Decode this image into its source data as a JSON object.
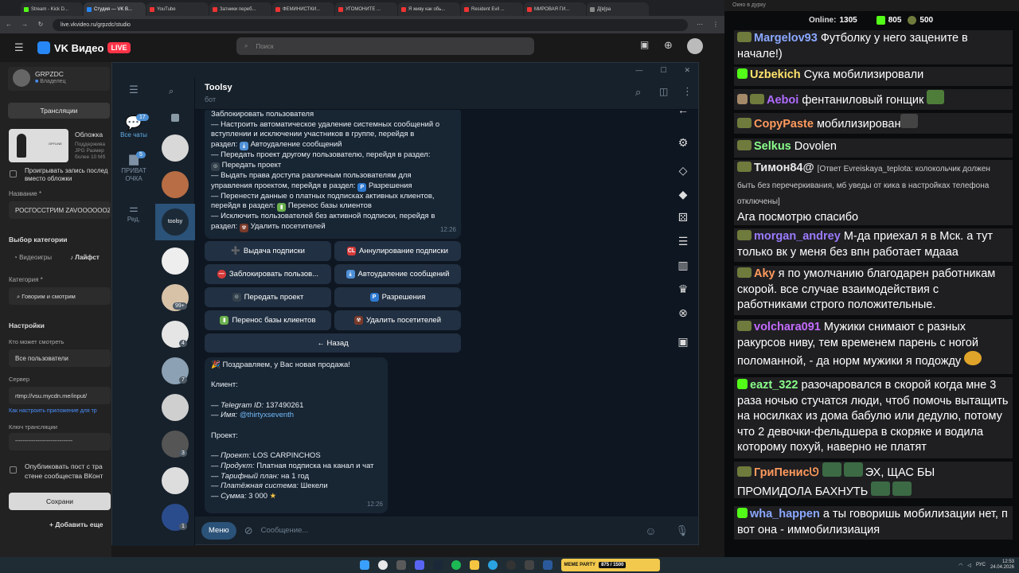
{
  "browser": {
    "tabs": [
      "Stream - Kick D...",
      "Студия — VK В...",
      "YouTube",
      "Затники переб...",
      "ФЕМИНИСТКИ...",
      "УГОМОНИТЕ ...",
      "Я живу как обь...",
      "Resident Evil ...",
      "МИРОВАЯ ГИ...",
      "Д[в]ра"
    ],
    "url": "live.vkvideo.ru/grpzdc/studio"
  },
  "vk": {
    "logo": "VK Видео",
    "live_badge": "LIVE",
    "search_placeholder": "Поиск",
    "channel_name": "GRPZDC",
    "channel_role": "Владелец",
    "tab_broadcasts": "Трансляции",
    "cover_title": "Обложка",
    "cover_hint_1": "Поддержива",
    "cover_hint_2": "JPG Размер",
    "cover_hint_3": "более 10 Мб",
    "cover_offline": "OFFLINE",
    "replay_label_1": "Проигрывать запись послед",
    "replay_label_2": "вместо обложки",
    "name_label": "Название *",
    "name_value": "РОСГОССТРИМ ZAVOOOOOOZ",
    "category_choice_label": "Выбор категории",
    "category_games": "Видеоигры",
    "category_lifestyle": "Лайфст",
    "category_label": "Категория *",
    "category_value": "Говорим и смотрим",
    "settings_label": "Настройки",
    "who_can_watch_label": "Кто может смотреть",
    "who_can_watch_value": "Все пользователи",
    "server_label": "Сервер",
    "server_value": "rtmp://vsu.mycdn.me/input/",
    "config_link": "Как настроить приложение для тр",
    "key_label": "Ключ трансляции",
    "key_value": "-------------------------------",
    "publish_label_1": "Опубликовать пост с тра",
    "publish_label_2": "стене сообщества ВКонт",
    "save_button": "Сохрани",
    "add_button": "Добавить еще"
  },
  "telegram": {
    "folders": [
      {
        "label": "Все чаты",
        "badge": "17"
      },
      {
        "label": "ПРИВАТ ОЧКА",
        "badge": "5"
      },
      {
        "label": "Ред.",
        "badge": ""
      }
    ],
    "chat_badges": [
      "99+",
      "4",
      "7",
      "3",
      "1"
    ],
    "toolsy_avatar_text": "toolsy",
    "chat_name": "Toolsy",
    "chat_status": "бот",
    "bot_message_lines": [
      "Заблокировать пользователя",
      "— Настроить автоматическое удаление системных сообщений о",
      "вступлении и исключении участников в группе, перейдя в",
      "раздел:",
      "Автоудаление сообщений",
      "— Передать проект другому пользователю, перейдя в раздел:",
      "Передать проект",
      "— Выдать права доступа различным пользователям для",
      "управления проектом, перейдя в раздел:",
      "Разрешения",
      "— Перенести данные о платных подписках активных клиентов,",
      "перейдя в раздел:",
      "Перенос базы клиентов",
      "— Исключить пользователей без активной подписки, перейдя в",
      "раздел:",
      "Удалить посетителей"
    ],
    "bot_message_time": "12:26",
    "keyboard": {
      "issue": "Выдача подписки",
      "cancel": "Аннулирование подписки",
      "block": "Заблокировать пользов...",
      "autodelete": "Автоудаление сообщений",
      "transfer": "Передать проект",
      "permissions": "Разрешения",
      "migrate": "Перенос базы клиентов",
      "remove": "Удалить посетителей",
      "back": "← Назад"
    },
    "sale": {
      "title": "Поздравляем, у Вас новая продажа!",
      "client_label": "Клиент:",
      "tg_id_label": "— Telegram ID:",
      "tg_id": "137490261",
      "name_label": "— Имя:",
      "name": "@thirtyxseventh",
      "project_label": "Проект:",
      "project_key": "— Проект:",
      "project": "LOS CARPINCHOS",
      "product_key": "— Продукт:",
      "product": "Платная подписка на канал и чат",
      "plan_key": "— Тарифный план:",
      "plan": "на 1 год",
      "payment_key": "— Платёжная система:",
      "payment": "Шекели",
      "sum_key": "— Сумма:",
      "sum": "3 000",
      "time": "12:26"
    },
    "menu_button": "Меню",
    "compose_placeholder": "Сообщение..."
  },
  "chat_panel": {
    "window_title": "Окно в дурку",
    "online_label": "Online:",
    "online_count": "1305",
    "kick_count": "805",
    "other_count": "500",
    "messages": [
      {
        "user": "Margelov93",
        "text": "Футболку у него зацените в начале!)",
        "color": "#8aa8ff"
      },
      {
        "user": "Uzbekich",
        "text": "Сука мобилизировали",
        "color": "#ffe26b"
      },
      {
        "user": "Aeboi",
        "text": "фентаниловый гонщик",
        "color": "#b06bff"
      },
      {
        "user": "CopyPaste",
        "text": "мобилизирован",
        "color": "#ff9a5c"
      },
      {
        "user": "Selkus",
        "text": "Dovolen",
        "color": "#8bff8b"
      },
      {
        "user": "Тимон84@",
        "text": "[Ответ Evreiskaya_teplota: колокольчик должен быть без перечеркивания, мб уведы от кика в настройках телефона отключены]",
        "text2": "Ага посмотрю спасибо",
        "color": "#e8e8e8"
      },
      {
        "user": "morgan_andrey",
        "text": "М-да приехал я в Мск. а тут только вк у меня без впн работает мдааа",
        "color": "#9b7bff"
      },
      {
        "user": "Aky",
        "text": "я по умолчанию благодарен работникам скорой. все случае взаимодействия с работниками строго положительные.",
        "color": "#ff9a5c"
      },
      {
        "user": "volchara091",
        "text": "Мужики снимают с разных ракурсов ниву, тем временем парень с ногой поломанной, - да норм мужики я подожду",
        "color": "#c36bff"
      },
      {
        "user": "eazt_322",
        "text": "разочаровался в скорой когда мне 3 раза ночью стучатся люди, чтоб помочь вытащить на носилках из дома бабулю или дедулю, потому что 2 девочки-фельдшера в скоряке и водила которому похуй, наверно не платят",
        "color": "#8bff8b"
      },
      {
        "user": "ГриПенисᘎ",
        "text": "ЭХ, ЩАС БЫ ПРОМИДОЛА БАХНУТЬ",
        "color": "#ff9a5c"
      },
      {
        "user": "wha_happen",
        "text": "а ты говоришь мобилизации нет, п вот она - иммобилизиация",
        "color": "#8aa8ff"
      }
    ]
  },
  "taskbar": {
    "meme_party": "MEME PARTY",
    "meme_counts": "875 / 1500",
    "language": "РУС",
    "time": "12:53",
    "date": "24.04.2026"
  }
}
